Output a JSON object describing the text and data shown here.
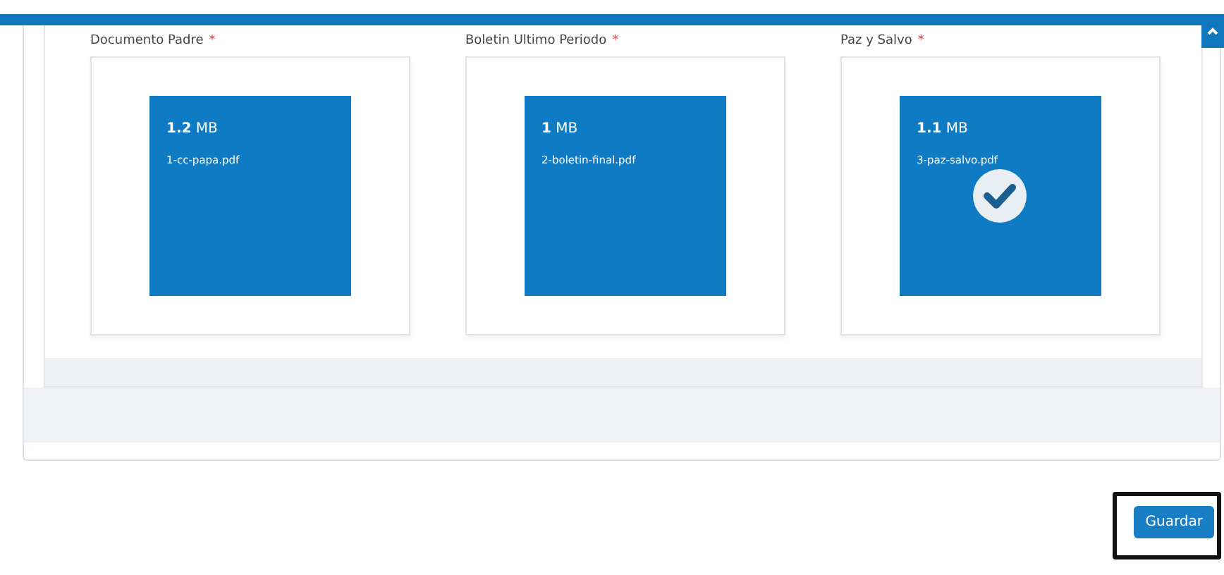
{
  "uploads": [
    {
      "label": "Documento Padre",
      "required_mark": "*",
      "size_value": "1.2",
      "size_unit": "MB",
      "file_name": "1-cc-papa.pdf",
      "uploaded": false
    },
    {
      "label": "Boletin Ultimo Periodo",
      "required_mark": "*",
      "size_value": "1",
      "size_unit": "MB",
      "file_name": "2-boletin-final.pdf",
      "uploaded": false
    },
    {
      "label": "Paz y Salvo",
      "required_mark": "*",
      "size_value": "1.1",
      "size_unit": "MB",
      "file_name": "3-paz-salvo.pdf",
      "uploaded": true
    }
  ],
  "save_button": {
    "label": "Guardar",
    "highlighted": true
  }
}
